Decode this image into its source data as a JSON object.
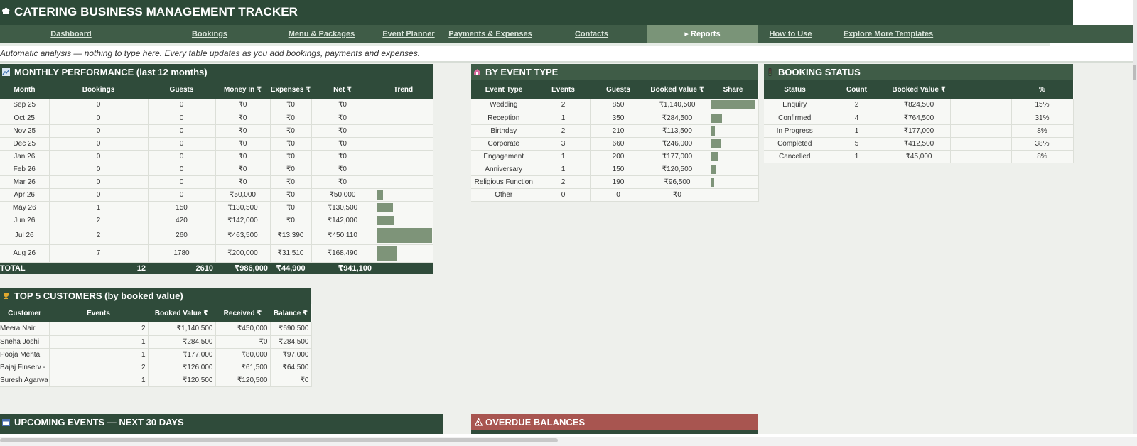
{
  "app": {
    "title": "CATERING BUSINESS MANAGEMENT TRACKER"
  },
  "nav": [
    {
      "label": "Dashboard",
      "active": false
    },
    {
      "label": "Bookings",
      "active": false
    },
    {
      "label": "Menu & Packages",
      "active": false
    },
    {
      "label": "Event Planner",
      "active": false
    },
    {
      "label": "Payments & Expenses",
      "active": false
    },
    {
      "label": "Contacts",
      "active": false
    },
    {
      "label": "▸ Reports",
      "active": true
    },
    {
      "label": "How to Use",
      "active": false
    },
    {
      "label": "Explore More Templates",
      "active": false
    }
  ],
  "note": "Automatic analysis — nothing to type here. Every table updates as you add bookings, payments and expenses.",
  "monthly": {
    "title": "MONTHLY PERFORMANCE (last 12 months)",
    "headers": [
      "Month",
      "Bookings",
      "Guests",
      "Money In ₹",
      "Expenses ₹",
      "Net ₹",
      "Trend"
    ],
    "rows": [
      {
        "month": "Sep 25",
        "bookings": "0",
        "guests": "0",
        "in": "₹0",
        "exp": "₹0",
        "net": "₹0",
        "trend": 0
      },
      {
        "month": "Oct 25",
        "bookings": "0",
        "guests": "0",
        "in": "₹0",
        "exp": "₹0",
        "net": "₹0",
        "trend": 0
      },
      {
        "month": "Nov 25",
        "bookings": "0",
        "guests": "0",
        "in": "₹0",
        "exp": "₹0",
        "net": "₹0",
        "trend": 0
      },
      {
        "month": "Dec 25",
        "bookings": "0",
        "guests": "0",
        "in": "₹0",
        "exp": "₹0",
        "net": "₹0",
        "trend": 0
      },
      {
        "month": "Jan 26",
        "bookings": "0",
        "guests": "0",
        "in": "₹0",
        "exp": "₹0",
        "net": "₹0",
        "trend": 0
      },
      {
        "month": "Feb 26",
        "bookings": "0",
        "guests": "0",
        "in": "₹0",
        "exp": "₹0",
        "net": "₹0",
        "trend": 0
      },
      {
        "month": "Mar 26",
        "bookings": "0",
        "guests": "0",
        "in": "₹0",
        "exp": "₹0",
        "net": "₹0",
        "trend": 0
      },
      {
        "month": "Apr 26",
        "bookings": "0",
        "guests": "0",
        "in": "₹50,000",
        "exp": "₹0",
        "net": "₹50,000",
        "trend": 50000
      },
      {
        "month": "May 26",
        "bookings": "1",
        "guests": "150",
        "in": "₹130,500",
        "exp": "₹0",
        "net": "₹130,500",
        "trend": 130500
      },
      {
        "month": "Jun 26",
        "bookings": "2",
        "guests": "420",
        "in": "₹142,000",
        "exp": "₹0",
        "net": "₹142,000",
        "trend": 142000
      },
      {
        "month": "Jul 26",
        "bookings": "2",
        "guests": "260",
        "in": "₹463,500",
        "exp": "₹13,390",
        "net": "₹450,110",
        "trend": 450110,
        "tall": true
      },
      {
        "month": "Aug 26",
        "bookings": "7",
        "guests": "1780",
        "in": "₹200,000",
        "exp": "₹31,510",
        "net": "₹168,490",
        "trend": 168490,
        "tall": true
      }
    ],
    "total": {
      "label": "TOTAL",
      "bookings": "12",
      "guests": "2610",
      "in": "₹986,000",
      "exp": "₹44,900",
      "net": "₹941,100"
    }
  },
  "event_type": {
    "title": "BY EVENT TYPE",
    "headers": [
      "Event Type",
      "Events",
      "Guests",
      "Booked Value ₹",
      "Share"
    ],
    "rows": [
      {
        "type": "Wedding",
        "events": "2",
        "guests": "850",
        "value": "₹1,140,500",
        "share": 1140500
      },
      {
        "type": "Reception",
        "events": "1",
        "guests": "350",
        "value": "₹284,500",
        "share": 284500
      },
      {
        "type": "Birthday",
        "events": "2",
        "guests": "210",
        "value": "₹113,500",
        "share": 113500
      },
      {
        "type": "Corporate",
        "events": "3",
        "guests": "660",
        "value": "₹246,000",
        "share": 246000
      },
      {
        "type": "Engagement",
        "events": "1",
        "guests": "200",
        "value": "₹177,000",
        "share": 177000
      },
      {
        "type": "Anniversary",
        "events": "1",
        "guests": "150",
        "value": "₹120,500",
        "share": 120500
      },
      {
        "type": "Religious Function",
        "events": "2",
        "guests": "190",
        "value": "₹96,500",
        "share": 96500
      },
      {
        "type": "Other",
        "events": "0",
        "guests": "0",
        "value": "₹0",
        "share": 0
      }
    ]
  },
  "booking_status": {
    "title": "BOOKING STATUS",
    "headers": [
      "Status",
      "Count",
      "Booked Value ₹",
      "",
      "%"
    ],
    "rows": [
      {
        "status": "Enquiry",
        "count": "2",
        "value": "₹824,500",
        "pct": "15%"
      },
      {
        "status": "Confirmed",
        "count": "4",
        "value": "₹764,500",
        "pct": "31%"
      },
      {
        "status": "In Progress",
        "count": "1",
        "value": "₹177,000",
        "pct": "8%"
      },
      {
        "status": "Completed",
        "count": "5",
        "value": "₹412,500",
        "pct": "38%"
      },
      {
        "status": "Cancelled",
        "count": "1",
        "value": "₹45,000",
        "pct": "8%"
      }
    ]
  },
  "top_customers": {
    "title": "TOP 5 CUSTOMERS (by booked value)",
    "headers": [
      "Customer",
      "Events",
      "Booked Value ₹",
      "Received ₹",
      "Balance ₹"
    ],
    "rows": [
      {
        "name": "Meera Nair",
        "events": "2",
        "value": "₹1,140,500",
        "received": "₹450,000",
        "balance": "₹690,500"
      },
      {
        "name": "Sneha Joshi",
        "events": "1",
        "value": "₹284,500",
        "received": "₹0",
        "balance": "₹284,500"
      },
      {
        "name": "Pooja Mehta",
        "events": "1",
        "value": "₹177,000",
        "received": "₹80,000",
        "balance": "₹97,000"
      },
      {
        "name": "Bajaj Finserv -",
        "events": "2",
        "value": "₹126,000",
        "received": "₹61,500",
        "balance": "₹64,500"
      },
      {
        "name": "Suresh Agarwa",
        "events": "1",
        "value": "₹120,500",
        "received": "₹120,500",
        "balance": "₹0"
      }
    ]
  },
  "upcoming": {
    "title": "UPCOMING EVENTS — NEXT 30 DAYS"
  },
  "overdue": {
    "title": "OVERDUE BALANCES"
  },
  "colors": {
    "dark": "#2f4b3a",
    "nav": "#3f5c47",
    "active": "#7a9478",
    "bar": "#7e9479",
    "red": "#a85550",
    "bg": "#eef0ec"
  },
  "icons": {
    "title": "chef-hat-icon",
    "monthly": "chart-icon",
    "event": "party-icon",
    "status": "traffic-light-icon",
    "customers": "trophy-icon",
    "upcoming": "calendar-icon",
    "overdue": "warning-icon"
  }
}
